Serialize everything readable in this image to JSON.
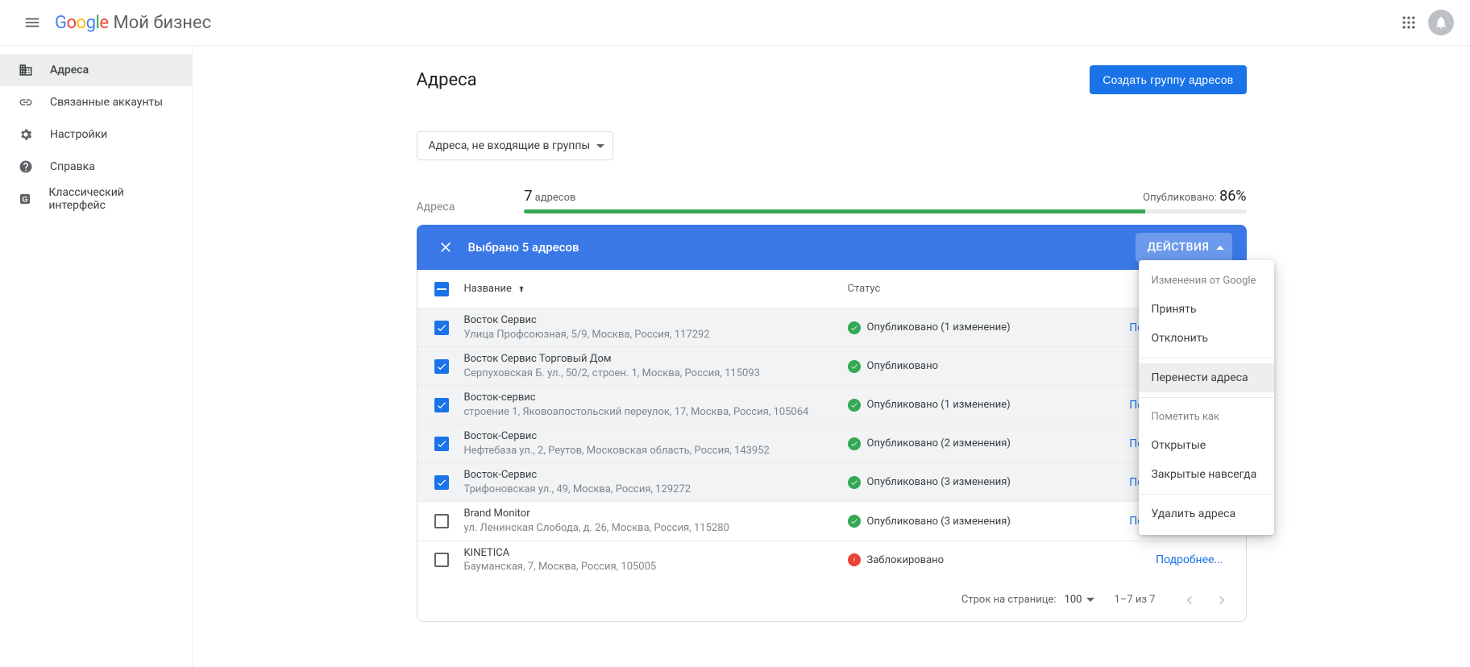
{
  "product_name": "Мой бизнес",
  "sidebar": {
    "items": [
      {
        "label": "Адреса",
        "icon": "business-icon"
      },
      {
        "label": "Связанные аккаунты",
        "icon": "link-icon"
      },
      {
        "label": "Настройки",
        "icon": "gear-icon"
      },
      {
        "label": "Справка",
        "icon": "help-icon"
      },
      {
        "label": "Классический интерфейс",
        "icon": "classic-icon"
      }
    ]
  },
  "page": {
    "title": "Адреса",
    "create_group_btn": "Создать группу адресов",
    "filter_label": "Адреса, не входящие в группы"
  },
  "stats": {
    "label": "Адреса",
    "count": "7",
    "count_suffix": "адресов",
    "published_label": "Опубликовано:",
    "published_pct": "86%",
    "bar_width": "86%"
  },
  "selection": {
    "text": "Выбрано 5 адресов",
    "actions_label": "ДЕЙСТВИЯ"
  },
  "table": {
    "headers": {
      "name": "Название",
      "status": "Статус"
    },
    "view_label": "Посмотреть изме",
    "more_label": "Подробнее...",
    "rows": [
      {
        "checked": true,
        "name": "Восток Сервис",
        "addr": "Улица Профсоюзная, 5/9, Москва, Россия, 117292",
        "status_text": "Опубликовано (1 изменение)",
        "status": "ok",
        "action": "view"
      },
      {
        "checked": true,
        "name": "Восток Сервис Торговый Дом",
        "addr": "Серпуховская Б. ул., 50/2, строен. 1, Москва, Россия, 115093",
        "status_text": "Опубликовано",
        "status": "ok",
        "action": ""
      },
      {
        "checked": true,
        "name": "Восток-сервис",
        "addr": "строение 1, Яковоапостольский переулок, 17, Москва, Россия, 105064",
        "status_text": "Опубликовано (1 изменение)",
        "status": "ok",
        "action": "view"
      },
      {
        "checked": true,
        "name": "Восток-Сервис",
        "addr": "Нефтебаза ул., 2, Реутов, Московская область, Россия, 143952",
        "status_text": "Опубликовано (2 изменения)",
        "status": "ok",
        "action": "view"
      },
      {
        "checked": true,
        "name": "Восток-Сервис",
        "addr": "Трифоновская ул., 49, Москва, Россия, 129272",
        "status_text": "Опубликовано (3 изменения)",
        "status": "ok",
        "action": "view"
      },
      {
        "checked": false,
        "name": "Brand Monitor",
        "addr": "ул. Ленинская Слобода, д. 26, Москва, Россия, 115280",
        "status_text": "Опубликовано (3 изменения)",
        "status": "ok",
        "action": "view"
      },
      {
        "checked": false,
        "name": "KINETICA",
        "addr": "Бауманская, 7, Москва, Россия, 105005",
        "status_text": "Заблокировано",
        "status": "bad",
        "action": "more"
      }
    ],
    "footer": {
      "rpp_label": "Строк на странице:",
      "rpp_value": "100",
      "range": "1–7 из 7"
    }
  },
  "menu": {
    "section1_head": "Изменения от Google",
    "accept": "Принять",
    "reject": "Отклонить",
    "transfer": "Перенести адреса",
    "section3_head": "Пометить как",
    "open": "Открытые",
    "closed": "Закрытые навсегда",
    "delete": "Удалить адреса"
  }
}
